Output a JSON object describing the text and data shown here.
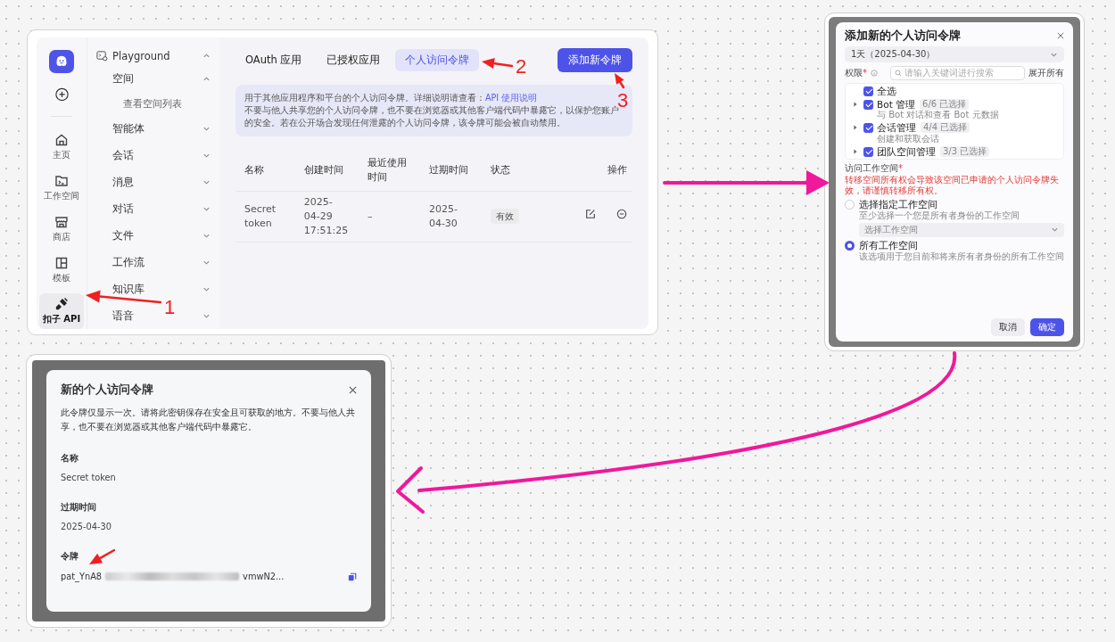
{
  "api_console": {
    "rail": {
      "items": [
        {
          "label": "主页",
          "selected": false
        },
        {
          "label": "工作空间",
          "selected": false
        },
        {
          "label": "商店",
          "selected": false
        },
        {
          "label": "模板",
          "selected": false
        },
        {
          "label": "扣子 API",
          "selected": true
        }
      ]
    },
    "nav": {
      "header": {
        "label": "Playground",
        "expanded": true
      },
      "items": [
        {
          "label": "空间",
          "expanded": true,
          "children": [
            {
              "label": "查看空间列表"
            }
          ]
        },
        {
          "label": "智能体",
          "expanded": false
        },
        {
          "label": "会话",
          "expanded": false
        },
        {
          "label": "消息",
          "expanded": false
        },
        {
          "label": "对话",
          "expanded": false
        },
        {
          "label": "文件",
          "expanded": false
        },
        {
          "label": "工作流",
          "expanded": false
        },
        {
          "label": "知识库",
          "expanded": false
        },
        {
          "label": "语音",
          "expanded": false
        }
      ]
    },
    "tabs": [
      {
        "label": "OAuth 应用",
        "selected": false
      },
      {
        "label": "已授权应用",
        "selected": false
      },
      {
        "label": "个人访问令牌",
        "selected": true
      }
    ],
    "add_button": "添加新令牌",
    "notice": {
      "text": "用于其他应用程序和平台的个人访问令牌。详细说明请查看：",
      "link": "API 使用说明",
      "text_2": "不要与他人共享您的个人访问令牌，也不要在浏览器或其他客户端代码中暴露它，以保护您账户的安全。若在公开场合发现任何泄露的个人访问令牌，该令牌可能会被自动禁用。"
    },
    "table": {
      "columns": [
        "名称",
        "创建时间",
        "最近使用时间",
        "过期时间",
        "状态",
        "操作"
      ],
      "rows": [
        {
          "cells": [
            "Secret token",
            "2025-04-29 17:51:25",
            "–",
            "2025-04-30"
          ],
          "status": "有效"
        }
      ]
    }
  },
  "add_token_dialog": {
    "title": "添加新的个人访问令牌",
    "expiry": "1天（2025-04-30）",
    "permissions_label": "权限",
    "required_mark": "*",
    "search_placeholder": "请输入关键词进行搜索",
    "expand_all": "展开所有",
    "permissions": [
      {
        "kind": "all",
        "label": "全选",
        "checked": true
      },
      {
        "kind": "group",
        "label": "Bot 管理",
        "count": "6/6 已选择",
        "description": "与 Bot 对话和查看 Bot 元数据",
        "checked": true
      },
      {
        "kind": "group",
        "label": "会话管理",
        "count": "4/4 已选择",
        "description": "创建和获取会话",
        "checked": true
      },
      {
        "kind": "group",
        "label": "团队空间管理",
        "count": "3/3 已选择",
        "checked": true
      }
    ],
    "workspace_label": "访问工作空间",
    "workspace_required_mark": "*",
    "warning": "转移空间所有权会导致该空间已申请的个人访问令牌失效，请谨慎转移所有权。",
    "workspace_options": [
      {
        "label": "选择指定工作空间",
        "description": "至少选择一个您是所有者身份的工作空间",
        "select_placeholder": "选择工作空间",
        "selected": false
      },
      {
        "label": "所有工作空间",
        "description": "该选项用于您目前和将来所有者身份的所有工作空间",
        "selected": true
      }
    ],
    "buttons": [
      {
        "label": "取消",
        "kind": "secondary"
      },
      {
        "label": "确定",
        "kind": "primary"
      }
    ]
  },
  "new_token_dialog": {
    "title": "新的个人访问令牌",
    "description": "此令牌仅显示一次。请将此密钥保存在安全且可获取的地方。不要与他人共享，也不要在浏览器或其他客户端代码中暴露它。",
    "fields": [
      {
        "label": "名称",
        "value": "Secret token"
      },
      {
        "label": "过期时间",
        "value": "2025-04-30"
      }
    ],
    "token": {
      "label": "令牌",
      "start": "pat_YnA8",
      "end": "vmwN2..."
    }
  },
  "annotations": [
    "1",
    "2",
    "3"
  ]
}
